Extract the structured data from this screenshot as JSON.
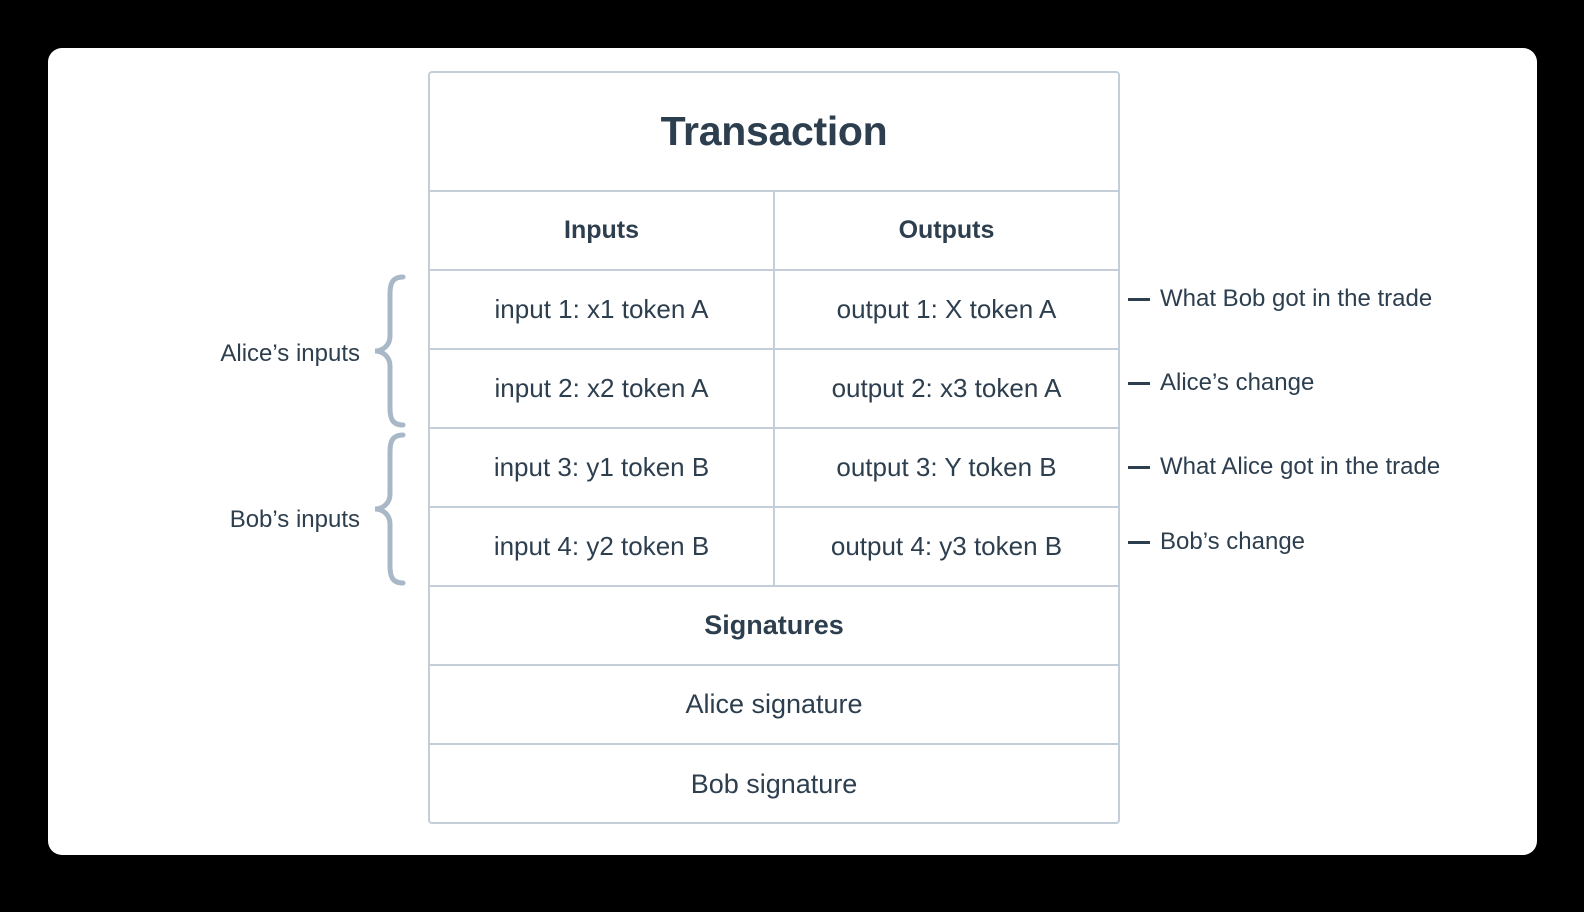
{
  "theme": {
    "page_background": "#000000",
    "card_background": "#ffffff",
    "border_color": "#c3ced9",
    "text_color": "#2d3e4e",
    "brace_color": "#a9b8c7"
  },
  "diagram": {
    "title": "Transaction",
    "columns": {
      "inputs": "Inputs",
      "outputs": "Outputs"
    },
    "rows": [
      {
        "input": "input 1: x1 token A",
        "output": "output 1: X token A"
      },
      {
        "input": "input 2: x2 token A",
        "output": "output 2: x3 token A"
      },
      {
        "input": "input 3: y1 token B",
        "output": "output 3: Y token B"
      },
      {
        "input": "input 4: y2 token B",
        "output": "output 4: y3 token B"
      }
    ],
    "signatures_header": "Signatures",
    "signatures": [
      "Alice signature",
      "Bob signature"
    ],
    "left_labels": [
      {
        "text": "Alice’s inputs",
        "spans_rows": [
          1,
          2
        ]
      },
      {
        "text": "Bob’s inputs",
        "spans_rows": [
          3,
          4
        ]
      }
    ],
    "right_annotations": [
      {
        "dash": "—",
        "text": "What Bob got in the trade",
        "for_row": 1
      },
      {
        "dash": "—",
        "text": "Alice’s change",
        "for_row": 2
      },
      {
        "dash": "—",
        "text": "What Alice got in the trade",
        "for_row": 3
      },
      {
        "dash": "—",
        "text": "Bob’s change",
        "for_row": 4
      }
    ]
  }
}
